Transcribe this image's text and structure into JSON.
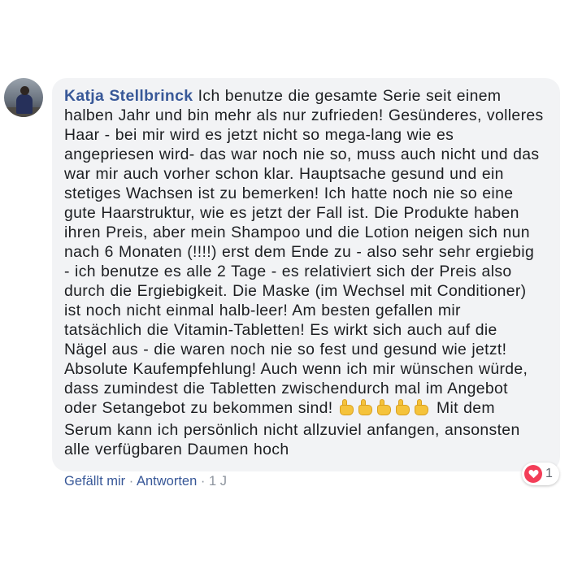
{
  "comment": {
    "author": "Katja Stellbrinck",
    "text_first_line": "Ich benutze die gesamte Serie seit einem",
    "lines": [
      "halben Jahr und bin mehr als nur zufrieden! Gesünderes, volleres",
      "Haar - bei mir wird es jetzt nicht so mega-lang wie es",
      "angepriesen wird- das war noch nie so, muss auch nicht und das",
      "war mir auch vorher schon klar. Hauptsache gesund und ein",
      "stetiges Wachsen ist zu bemerken! Ich hatte noch nie so eine",
      "gute Haarstruktur, wie es jetzt der Fall ist. Die Produkte haben",
      "ihren Preis, aber mein Shampoo und die Lotion neigen sich nun",
      "nach 6 Monaten (!!!!) erst dem Ende zu - also sehr sehr ergiebig",
      "- ich benutze es alle 2 Tage - es relativiert sich der Preis also",
      "durch die Ergiebigkeit. Die Maske (im Wechsel mit Conditioner)",
      "ist noch nicht einmal halb-leer! Am besten gefallen mir",
      "tatsächlich die Vitamin-Tabletten! Es wirkt sich auch auf die",
      "Nägel aus - die waren noch nie so fest und gesund wie jetzt!",
      "Absolute Kaufempfehlung! Auch wenn ich mir wünschen würde,",
      "dass zumindest die Tabletten zwischendurch mal im Angebot"
    ],
    "line_before_emoji": "oder Setangebot zu bekommen sind!",
    "line_after_emoji": "Mit dem",
    "emoji_count": 5,
    "emoji_icon": "thumbs-up-emoji",
    "closing_lines": [
      "Serum kann ich persönlich nicht allzuviel anfangen, ansonsten",
      "alle verfügbaren Daumen hoch"
    ]
  },
  "reaction": {
    "icon": "heart-icon",
    "count": "1",
    "color": "#f33e58"
  },
  "actions": {
    "like": "Gefällt mir",
    "separator": "·",
    "reply": "Antworten",
    "time": "1 J"
  },
  "colors": {
    "link": "#385898",
    "bubble": "#f2f3f5",
    "muted": "#8d949e"
  }
}
